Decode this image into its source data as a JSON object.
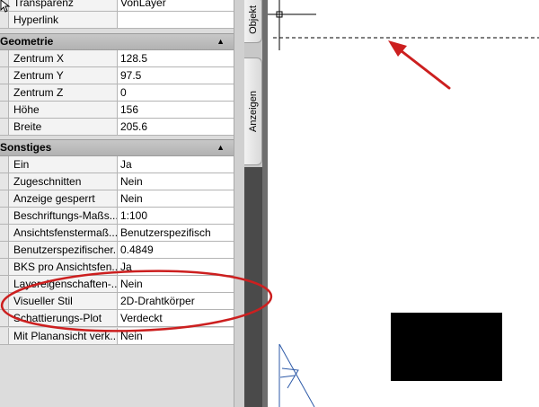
{
  "tabs": {
    "objekt": "Objekt",
    "anzeigen": "Anzeigen"
  },
  "sections": {
    "geometrie": "Geometrie",
    "sonstiges": "Sonstiges"
  },
  "rows": {
    "transparenz": {
      "name": "Transparenz",
      "value": "VonLayer"
    },
    "hyperlink": {
      "name": "Hyperlink",
      "value": ""
    },
    "zentrum_x": {
      "name": "Zentrum X",
      "value": "128.5"
    },
    "zentrum_y": {
      "name": "Zentrum Y",
      "value": "97.5"
    },
    "zentrum_z": {
      "name": "Zentrum Z",
      "value": "0"
    },
    "hoehe": {
      "name": "Höhe",
      "value": "156"
    },
    "breite": {
      "name": "Breite",
      "value": "205.6"
    },
    "ein": {
      "name": "Ein",
      "value": "Ja"
    },
    "zugeschnitten": {
      "name": "Zugeschnitten",
      "value": "Nein"
    },
    "anzeige_gesperrt": {
      "name": "Anzeige gesperrt",
      "value": "Nein"
    },
    "beschriftungs_mass": {
      "name": "Beschriftungs-Maßs...",
      "value": "1:100"
    },
    "ansichtsfenster_mass": {
      "name": "Ansichtsfenstermaß...",
      "value": "Benutzerspezifisch"
    },
    "benutzerspezifischer": {
      "name": "Benutzerspezifischer...",
      "value": "0.4849"
    },
    "bks_ansichtsfenster": {
      "name": "BKS pro Ansichtsfen...",
      "value": "Ja"
    },
    "layereigenschaften": {
      "name": "Layereigenschaften-...",
      "value": "Nein"
    },
    "visueller_stil": {
      "name": "Visueller Stil",
      "value": "2D-Drahtkörper"
    },
    "schattierungs_plot": {
      "name": "Schattierungs-Plot",
      "value": "Verdeckt"
    },
    "planansicht": {
      "name": "Mit Planansicht verk...",
      "value": "Nein"
    }
  },
  "colors": {
    "annotation_red": "#cc1f1f",
    "drawing_blue": "#2d5aa8"
  },
  "icons": {
    "collapse": "triangle-up",
    "cursor": "arrow-cursor"
  }
}
